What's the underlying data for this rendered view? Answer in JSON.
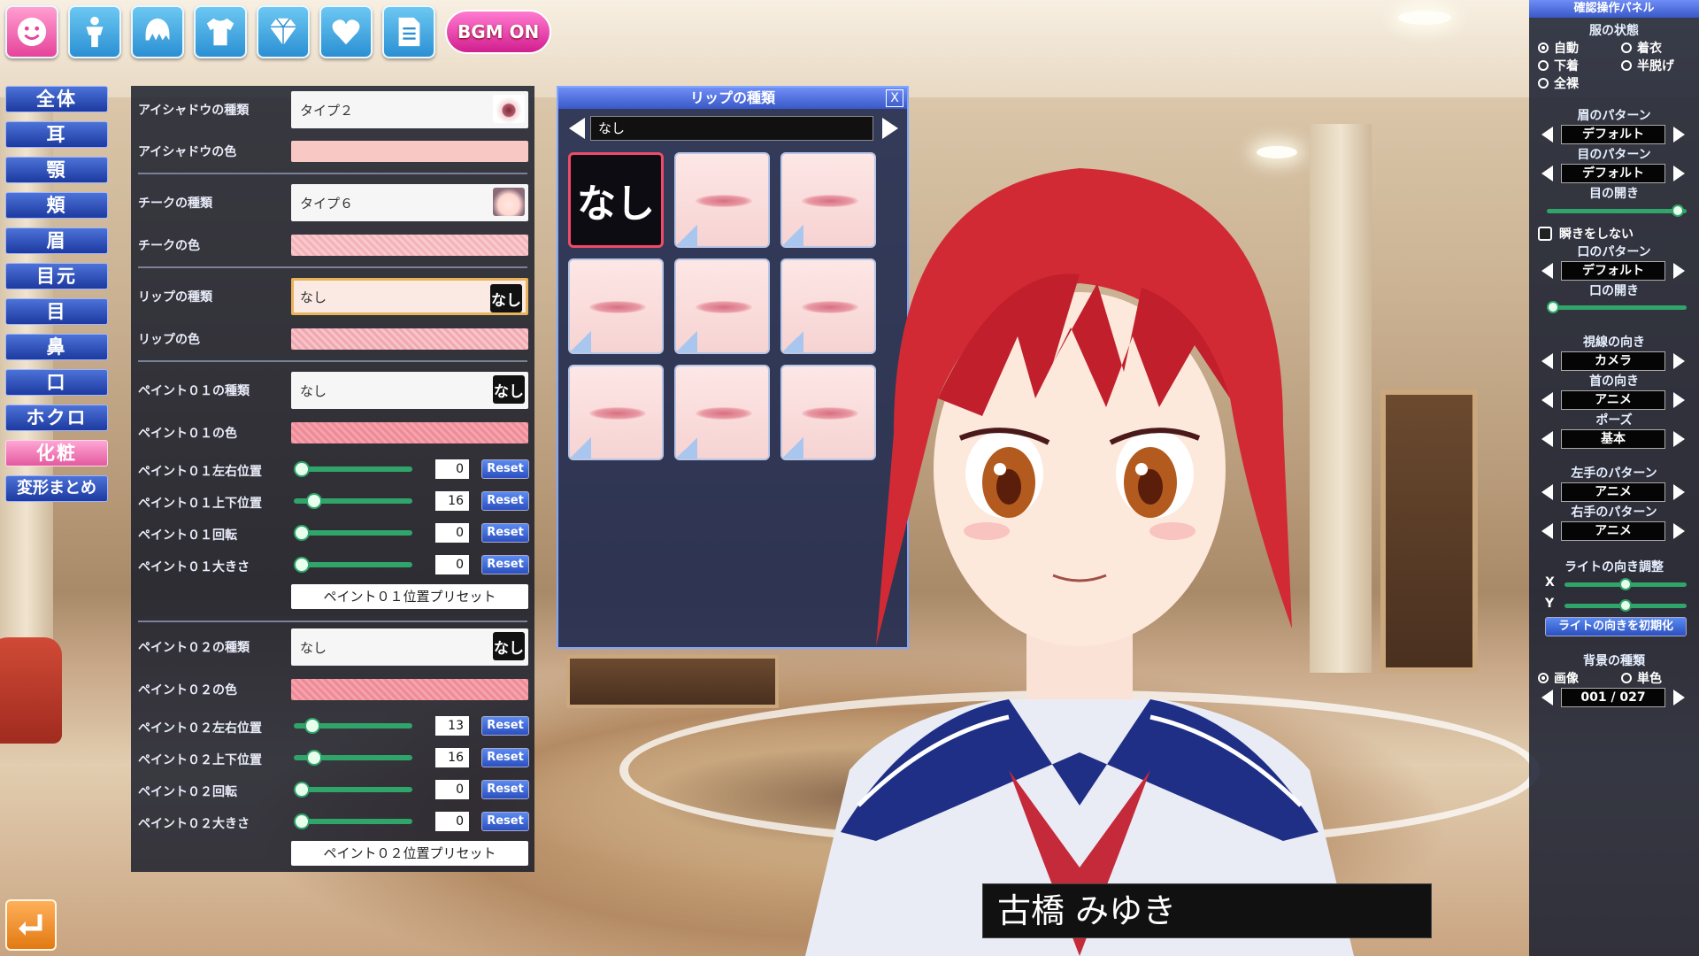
{
  "toolbar": {
    "icons": [
      "face-icon",
      "body-icon",
      "hair-icon",
      "clothes-icon",
      "accessory-icon",
      "heart-icon",
      "document-icon"
    ],
    "bgm_label": "BGM ON"
  },
  "categories": [
    {
      "label": "全体"
    },
    {
      "label": "耳"
    },
    {
      "label": "顎"
    },
    {
      "label": "頬"
    },
    {
      "label": "眉"
    },
    {
      "label": "目元"
    },
    {
      "label": "目"
    },
    {
      "label": "鼻"
    },
    {
      "label": "口"
    },
    {
      "label": "ホクロ"
    },
    {
      "label": "化粧",
      "active": true
    },
    {
      "label": "変形まとめ"
    }
  ],
  "panel": {
    "eyeshadow_type_label": "アイシャドウの種類",
    "eyeshadow_type_value": "タイプ２",
    "eyeshadow_color_label": "アイシャドウの色",
    "cheek_type_label": "チークの種類",
    "cheek_type_value": "タイプ６",
    "cheek_color_label": "チークの色",
    "lip_type_label": "リップの種類",
    "lip_type_value": "なし",
    "lip_color_label": "リップの色",
    "paint01_type_label": "ペイント０１の種類",
    "paint01_type_value": "なし",
    "paint01_color_label": "ペイント０１の色",
    "paint01_sliders": [
      {
        "label": "ペイント０１左右位置",
        "value": "0",
        "fraction": 0.0
      },
      {
        "label": "ペイント０１上下位置",
        "value": "16",
        "fraction": 0.12
      },
      {
        "label": "ペイント０１回転",
        "value": "0",
        "fraction": 0.0
      },
      {
        "label": "ペイント０１大きさ",
        "value": "0",
        "fraction": 0.0
      }
    ],
    "paint01_preset": "ペイント０１位置プリセット",
    "paint02_type_label": "ペイント０２の種類",
    "paint02_type_value": "なし",
    "paint02_color_label": "ペイント０２の色",
    "paint02_sliders": [
      {
        "label": "ペイント０２左右位置",
        "value": "13",
        "fraction": 0.1
      },
      {
        "label": "ペイント０２上下位置",
        "value": "16",
        "fraction": 0.12
      },
      {
        "label": "ペイント０２回転",
        "value": "0",
        "fraction": 0.0
      },
      {
        "label": "ペイント０２大きさ",
        "value": "0",
        "fraction": 0.0
      }
    ],
    "paint02_preset": "ペイント０２位置プリセット",
    "none_thumb": "なし",
    "reset_label": "Reset",
    "colors": {
      "eyeshadow": "#f7c8c4",
      "cheek": "#f4b3b8",
      "lip": "#f2a8b0",
      "paint01": "#f08a96",
      "paint02": "#f08a96"
    }
  },
  "popup": {
    "title": "リップの種類",
    "close": "X",
    "selected": "なし",
    "none_cell": "なし",
    "lip_count": 8
  },
  "character": {
    "name": "古橋 みゆき"
  },
  "right": {
    "header": "確認操作パネル",
    "clothes_title": "服の状態",
    "clothes_options": [
      "自動",
      "着衣",
      "下着",
      "半脱げ",
      "全裸"
    ],
    "eyebrow_title": "眉のパターン",
    "eyebrow_value": "デフォルト",
    "eye_title": "目のパターン",
    "eye_value": "デフォルト",
    "eye_open_title": "目の開き",
    "eye_open_fraction": 0.98,
    "no_blink_label": "瞬きをしない",
    "mouth_title": "口のパターン",
    "mouth_value": "デフォルト",
    "mouth_open_title": "口の開き",
    "mouth_open_fraction": 0.0,
    "gaze_title": "視線の向き",
    "gaze_value": "カメラ",
    "neck_title": "首の向き",
    "neck_value": "アニメ",
    "pose_title": "ポーズ",
    "pose_value": "基本",
    "lefthand_title": "左手のパターン",
    "lefthand_value": "アニメ",
    "righthand_title": "右手のパターン",
    "righthand_value": "アニメ",
    "light_title": "ライトの向き調整",
    "light_x": "X",
    "light_y": "Y",
    "light_x_fraction": 0.5,
    "light_y_fraction": 0.5,
    "light_reset": "ライトの向きを初期化",
    "bg_title": "背景の種類",
    "bg_options": [
      "画像",
      "単色"
    ],
    "bg_counter": "001 / 027"
  }
}
